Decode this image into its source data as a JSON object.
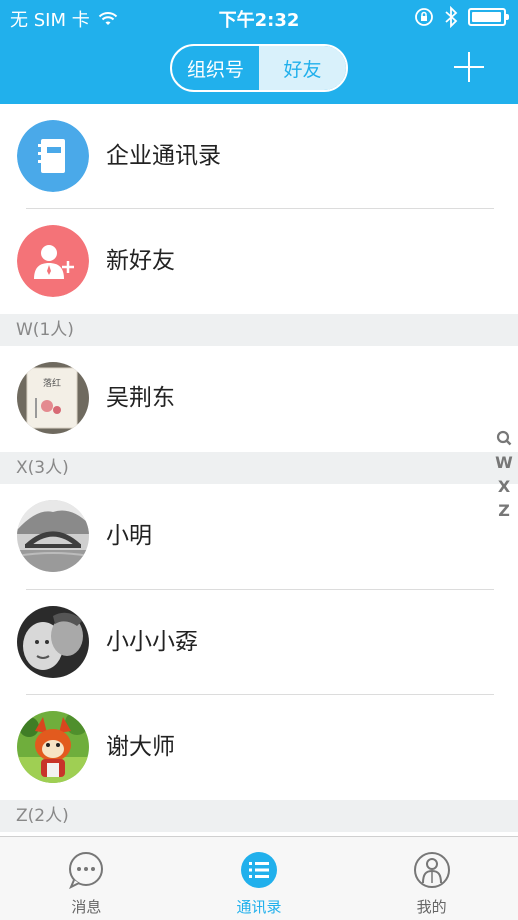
{
  "status_bar": {
    "carrier": "无 SIM 卡",
    "time": "下午2:32",
    "battery_level": 0.95
  },
  "header": {
    "segments": [
      {
        "label": "组织号",
        "active": false
      },
      {
        "label": "好友",
        "active": true
      }
    ],
    "add_icon": "plus-icon"
  },
  "entries": [
    {
      "label": "企业通讯录",
      "icon": "address-book-icon",
      "color": "#4aa9e9"
    },
    {
      "label": "新好友",
      "icon": "add-friend-icon",
      "color": "#f47378"
    }
  ],
  "sections": [
    {
      "title": "W(1人)",
      "contacts": [
        {
          "name": "吴荆东"
        }
      ]
    },
    {
      "title": "X(3人)",
      "contacts": [
        {
          "name": "小明"
        },
        {
          "name": "小小小孬"
        },
        {
          "name": "谢大师"
        }
      ]
    },
    {
      "title": "Z(2人)",
      "contacts": []
    }
  ],
  "index_bar": {
    "search_icon": "search-icon",
    "letters": [
      "W",
      "X",
      "Z"
    ]
  },
  "tabbar": {
    "tabs": [
      {
        "label": "消息",
        "icon": "chat-bubble-icon",
        "active": false
      },
      {
        "label": "通讯录",
        "icon": "contacts-list-icon",
        "active": true
      },
      {
        "label": "我的",
        "icon": "profile-icon",
        "active": false
      }
    ]
  },
  "colors": {
    "accent": "#21b0ec",
    "section_bg": "#eef0f1"
  }
}
